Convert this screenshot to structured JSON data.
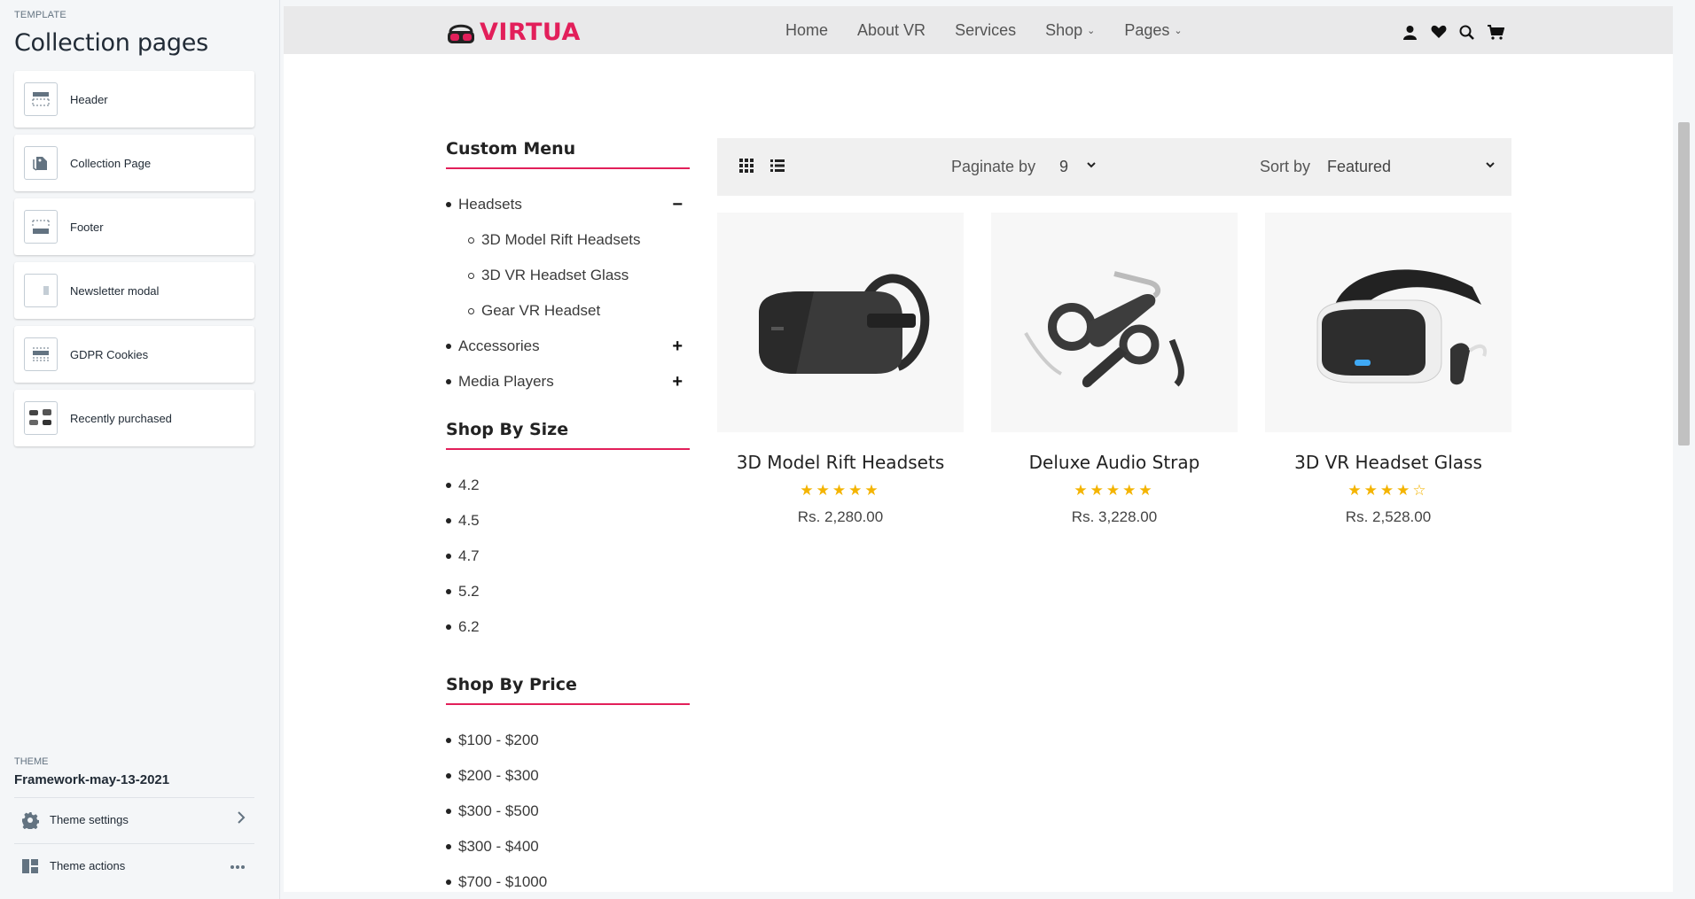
{
  "editor": {
    "template_label": "TEMPLATE",
    "title": "Collection pages",
    "sections": [
      {
        "label": "Header",
        "icon": "header-layout-icon"
      },
      {
        "label": "Collection Page",
        "icon": "collection-tag-icon"
      },
      {
        "label": "Footer",
        "icon": "footer-layout-icon"
      },
      {
        "label": "Newsletter modal",
        "icon": "modal-layout-icon"
      },
      {
        "label": "GDPR Cookies",
        "icon": "cookie-banner-icon"
      },
      {
        "label": "Recently purchased",
        "icon": "product-grid-icon"
      }
    ],
    "theme_label": "THEME",
    "theme_name": "Framework-may-13-2021",
    "theme_settings": "Theme settings",
    "theme_actions": "Theme actions"
  },
  "store": {
    "logo_text": "VIRTUA",
    "brand_color": "#e21f5a",
    "nav": [
      {
        "label": "Home",
        "has_dropdown": false
      },
      {
        "label": "About VR",
        "has_dropdown": false
      },
      {
        "label": "Services",
        "has_dropdown": false
      },
      {
        "label": "Shop",
        "has_dropdown": true
      },
      {
        "label": "Pages",
        "has_dropdown": true
      }
    ],
    "nav_icons": [
      "user-icon",
      "heart-icon",
      "search-icon",
      "cart-icon"
    ]
  },
  "filters": {
    "custom_menu": {
      "title": "Custom Menu",
      "items": [
        {
          "label": "Headsets",
          "level": 1,
          "toggle": "−"
        },
        {
          "label": "3D Model Rift Headsets",
          "level": 2
        },
        {
          "label": "3D VR Headset Glass",
          "level": 2
        },
        {
          "label": "Gear VR Headset",
          "level": 2
        },
        {
          "label": "Accessories",
          "level": 1,
          "toggle": "+"
        },
        {
          "label": "Media Players",
          "level": 1,
          "toggle": "+"
        }
      ]
    },
    "shop_by_size": {
      "title": "Shop By Size",
      "items": [
        "4.2",
        "4.5",
        "4.7",
        "5.2",
        "6.2"
      ]
    },
    "shop_by_price": {
      "title": "Shop By Price",
      "items": [
        "$100 - $200",
        "$200 - $300",
        "$300 - $500",
        "$300 - $400",
        "$700 - $1000"
      ]
    }
  },
  "toolbar": {
    "paginate_label": "Paginate by",
    "paginate_value": "9",
    "sort_label": "Sort by",
    "sort_value": "Featured"
  },
  "products": [
    {
      "name": "3D Model Rift Headsets",
      "rating": 5,
      "stars": "★★★★★",
      "price": "Rs. 2,280.00"
    },
    {
      "name": "Deluxe Audio Strap",
      "rating": 5,
      "stars": "★★★★★",
      "price": "Rs. 3,228.00"
    },
    {
      "name": "3D VR Headset Glass",
      "rating": 4,
      "stars": "★★★★☆",
      "price": "Rs. 2,528.00"
    }
  ]
}
